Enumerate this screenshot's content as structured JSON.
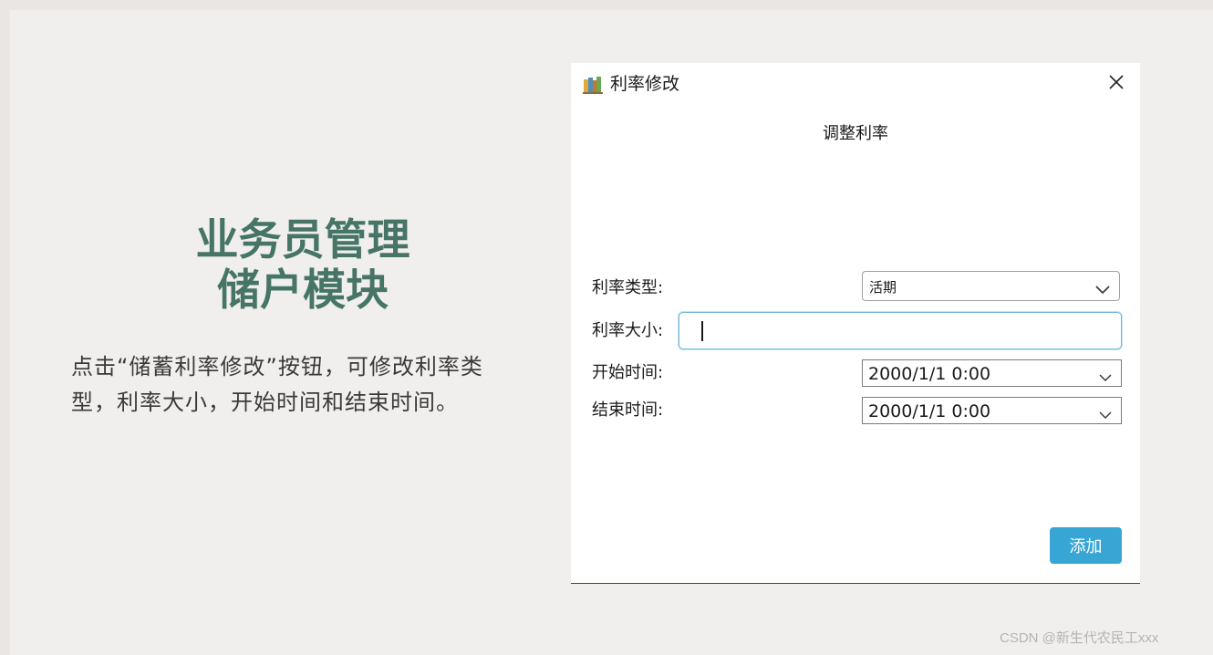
{
  "slide": {
    "heading_line1": "业务员管理",
    "heading_line2": "储户模块",
    "description": "点击“储蓄利率修改”按钮，可修改利率类型，利率大小，开始时间和结束时间。"
  },
  "dialog": {
    "window_title": "利率修改",
    "section_title": "调整利率",
    "rate_type": {
      "label": "利率类型:",
      "value": "活期"
    },
    "rate_size": {
      "label": "利率大小:",
      "value": ""
    },
    "start_time": {
      "label": "开始时间:",
      "value": "2000/1/1 0:00"
    },
    "end_time": {
      "label": "结束时间:",
      "value": "2000/1/1 0:00"
    },
    "add_label": "添加"
  },
  "watermark": "CSDN @新生代农民工xxx",
  "colors": {
    "heading": "#467567",
    "button": "#37a6d4",
    "input_focus": "#6fb7d8",
    "slide_bg": "#f1efed"
  },
  "icons": {
    "app": "books-icon",
    "close": "close-icon",
    "dropdown": "chevron-down-icon"
  }
}
